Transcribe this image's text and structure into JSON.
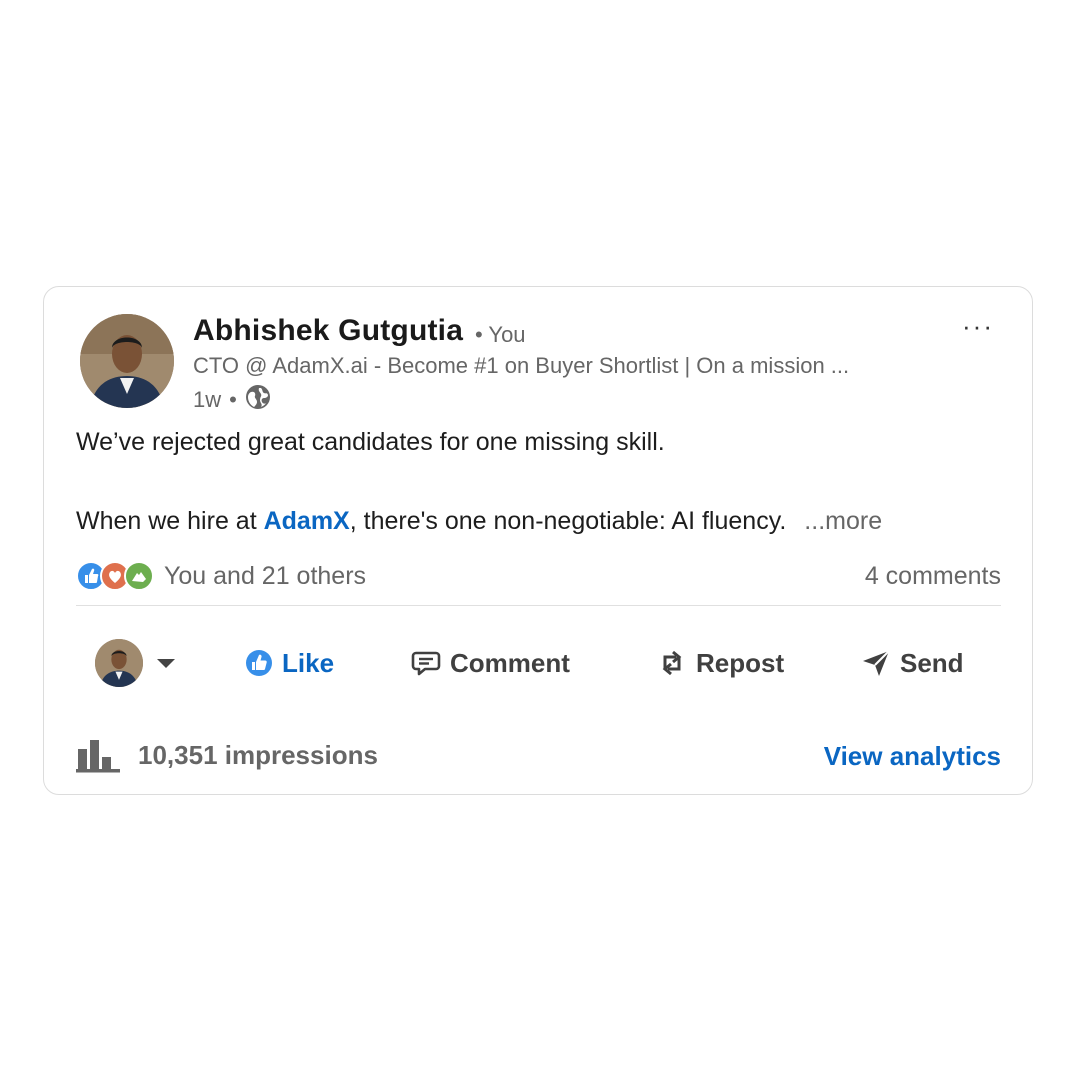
{
  "post": {
    "author": {
      "name": "Abhishek Gutgutia",
      "relation": "• You",
      "headline": "CTO @ AdamX.ai - Become #1 on Buyer Shortlist | On a mission ...",
      "time": "1w",
      "visibility_icon": "globe-icon"
    },
    "menu_icon": "···",
    "body": {
      "line1": "We’ve rejected great candidates for one missing skill.",
      "line2_prefix": "When we hire at ",
      "mention": "AdamX",
      "line2_suffix": ", there's one non-negotiable: AI fluency.",
      "see_more": "...more"
    },
    "social": {
      "reaction_icons": [
        "like-reaction-icon",
        "love-reaction-icon",
        "support-reaction-icon"
      ],
      "reactions_text": "You and 21 others",
      "comments_text": "4 comments"
    },
    "actions": {
      "like": "Like",
      "comment": "Comment",
      "repost": "Repost",
      "send": "Send"
    },
    "footer": {
      "impressions": "10,351 impressions",
      "analytics_link": "View analytics"
    },
    "colors": {
      "accent": "#0a66c2",
      "muted": "#666666",
      "border": "#dcdcdc"
    }
  }
}
